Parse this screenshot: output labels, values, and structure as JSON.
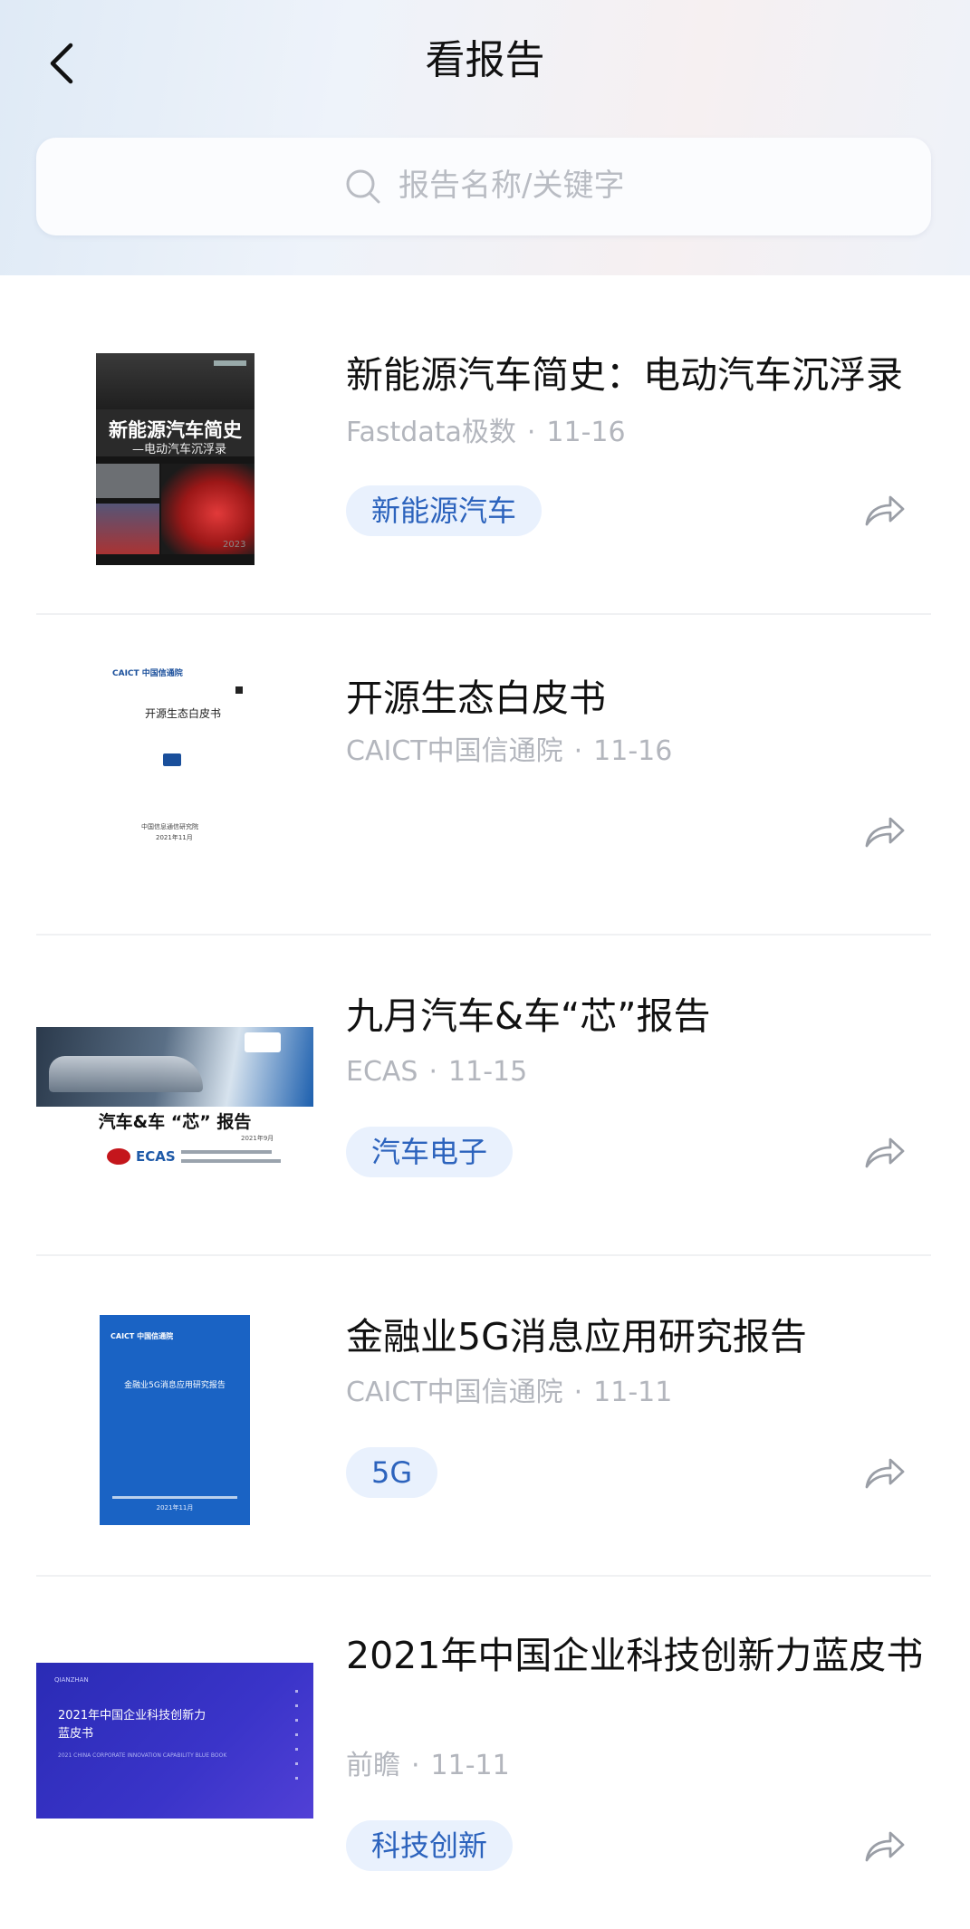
{
  "header": {
    "title": "看报告"
  },
  "search": {
    "placeholder": "报告名称/关键字"
  },
  "reports": [
    {
      "title": "新能源汽车简史：电动汽车沉浮录",
      "source": "Fastdata极数",
      "date": "11-16",
      "tag": "新能源汽车",
      "thumb": {
        "cover_title": "新能源汽车简史",
        "cover_subtitle": "—电动汽车沉浮录",
        "year": "2023"
      }
    },
    {
      "title": "开源生态白皮书",
      "source": "CAICT中国信通院",
      "date": "11-16",
      "tag": "",
      "thumb": {
        "org": "CAICT 中国信通院",
        "cover_title": "开源生态白皮书",
        "footer_line1": "中国信息通信研究院",
        "footer_line2": "2021年11月"
      }
    },
    {
      "title": "九月汽车&车“芯”报告",
      "source": "ECAS",
      "date": "11-15",
      "tag": "汽车电子",
      "thumb": {
        "cover_title": "汽车&车 “芯” 报告",
        "brand": "ECAS",
        "date_line": "2021年9月"
      }
    },
    {
      "title": "金融业5G消息应用研究报告",
      "source": "CAICT中国信通院",
      "date": "11-11",
      "tag": "5G",
      "thumb": {
        "org": "CAICT 中国信通院",
        "cover_title": "金融业5G消息应用研究报告",
        "date_line": "2021年11月"
      }
    },
    {
      "title": "2021年中国企业科技创新力蓝皮书",
      "source": "前瞻",
      "date": "11-11",
      "tag": "科技创新",
      "thumb": {
        "brand": "QIANZHAN",
        "cover_title": "2021年中国企业科技创新力",
        "cover_title2": "蓝皮书",
        "cover_en": "2021 CHINA CORPORATE INNOVATION CAPABILITY BLUE BOOK"
      }
    }
  ],
  "colors": {
    "tag_bg": "#e9f1fd",
    "tag_text": "#2c63bd",
    "meta": "#b3b6bd",
    "cover_blue": "#1a63c4",
    "cover_violet": "#3a34c9"
  },
  "icons": {
    "back": "chevron-left-icon",
    "search": "search-icon",
    "share": "share-arrow-icon"
  }
}
